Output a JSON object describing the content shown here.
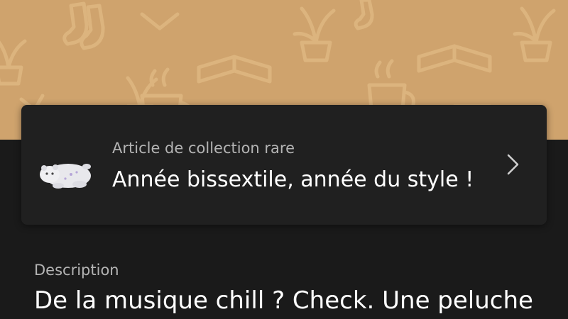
{
  "banner": {
    "pattern_color": "#d9b07a",
    "background_color": "#cfa36d",
    "icons": [
      "sock-icon",
      "potted-plant-icon",
      "open-book-icon",
      "coffee-mug-icon"
    ]
  },
  "item_card": {
    "subtitle": "Article de collection rare",
    "title": "Année bissextile, année du style !",
    "thumbnail_icon": "plush-toy-icon",
    "chevron_icon": "chevron-right-icon"
  },
  "description": {
    "label": "Description",
    "text": "De la musique chill ? Check. Une peluche"
  }
}
